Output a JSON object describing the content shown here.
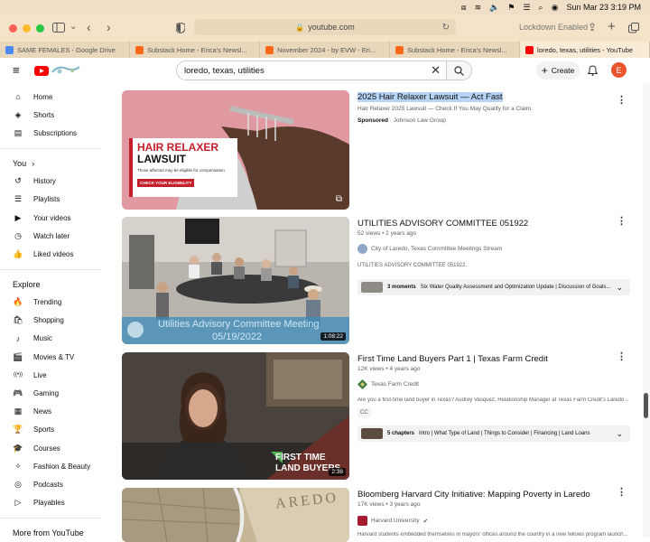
{
  "menubar": {
    "lockdown": "Lockdown Enabled",
    "datetime": "Sun Mar 23  3:19 PM"
  },
  "url": "youtube.com",
  "tabs": [
    {
      "label": "SAME FEMALES - Google Drive",
      "color": "#4a8af4"
    },
    {
      "label": "Substack Home - Erica's Newsl...",
      "color": "#ff6719"
    },
    {
      "label": "November 2024 - by EVW - Eri...",
      "color": "#ff6719"
    },
    {
      "label": "Substack Home - Erica's Newsl...",
      "color": "#ff6719"
    },
    {
      "label": "loredo, texas, utilities - YouTube",
      "color": "#ff0000"
    }
  ],
  "search": {
    "query": "loredo, texas, utilities"
  },
  "header": {
    "create": "Create",
    "avatar": "E"
  },
  "sidebar": {
    "top": [
      {
        "label": "Home",
        "icon": "home-icon"
      },
      {
        "label": "Shorts",
        "icon": "shorts-icon"
      },
      {
        "label": "Subscriptions",
        "icon": "subscriptions-icon"
      }
    ],
    "you_heading": "You",
    "you": [
      {
        "label": "History",
        "icon": "history-icon"
      },
      {
        "label": "Playlists",
        "icon": "playlists-icon"
      },
      {
        "label": "Your videos",
        "icon": "your-videos-icon"
      },
      {
        "label": "Watch later",
        "icon": "watch-later-icon"
      },
      {
        "label": "Liked videos",
        "icon": "liked-icon"
      }
    ],
    "explore_heading": "Explore",
    "explore": [
      {
        "label": "Trending",
        "icon": "trending-icon"
      },
      {
        "label": "Shopping",
        "icon": "shopping-icon"
      },
      {
        "label": "Music",
        "icon": "music-icon"
      },
      {
        "label": "Movies & TV",
        "icon": "movies-icon"
      },
      {
        "label": "Live",
        "icon": "live-icon"
      },
      {
        "label": "Gaming",
        "icon": "gaming-icon"
      },
      {
        "label": "News",
        "icon": "news-icon"
      },
      {
        "label": "Sports",
        "icon": "sports-icon"
      },
      {
        "label": "Courses",
        "icon": "courses-icon"
      },
      {
        "label": "Fashion & Beauty",
        "icon": "fashion-icon"
      },
      {
        "label": "Podcasts",
        "icon": "podcasts-icon"
      },
      {
        "label": "Playables",
        "icon": "playables-icon"
      }
    ],
    "more_heading": "More from YouTube"
  },
  "videos": [
    {
      "title": "2025 Hair Relaxer Lawsuit — Act Fast",
      "desc": "Hair Relaxer 2025 Lawsuit — Check If You May Qualify for a Claim.",
      "sponsored": "Sponsored",
      "advertiser": "· Johnson Law Group",
      "thumb": {
        "headline": "HAIR RELAXER",
        "headline2": "LAWSUIT",
        "sub": "Those affected may be eligible for compensation",
        "cta": "CHECK YOUR ELIGIBILITY"
      }
    },
    {
      "title": "UTILITIES ADVISORY COMMITTEE 051922",
      "meta": "52 views • 2 years ago",
      "channel": "City of Laredo, Texas Committee Meetings Stream",
      "desc": "UTILITIES ADVISORY COMMITTEE 051922.",
      "moments_label": "3 moments",
      "moments_text": "Six Water Quality Assessment and Optimization Update | Discussion of Goals...",
      "duration": "1:08:22",
      "overlay1": "Utilities Advisory Committee Meeting",
      "overlay2": "05/19/2022"
    },
    {
      "title": "First Time Land Buyers Part 1 | Texas Farm Credit",
      "meta": "12K views • 4 years ago",
      "channel": "Texas Farm Credit",
      "desc": "Are you a first-time land buyer in Texas? Audrey Vasquez, Relationship Manager at Texas Farm Credit's Laredo ...",
      "badge": "CC",
      "moments_label": "5 chapters",
      "moments_text": "Intro | What Type of Land | Things to Consider | Financing | Land Loans",
      "duration": "2:38",
      "overlay1": "FIRST TIME",
      "overlay2": "LAND BUYERS"
    },
    {
      "title": "Bloomberg Harvard City Initiative: Mapping Poverty in Laredo",
      "meta": "17K views • 3 years ago",
      "channel": "Harvard University",
      "desc": "Harvard students embedded themselves in mayors' offices around the country in a new fellows program launch...",
      "overlay1": "AREDO"
    }
  ],
  "colors": {
    "yt_red": "#ff0000",
    "accent_orange": "#e9542c",
    "highlight": "#b7d4f6"
  }
}
